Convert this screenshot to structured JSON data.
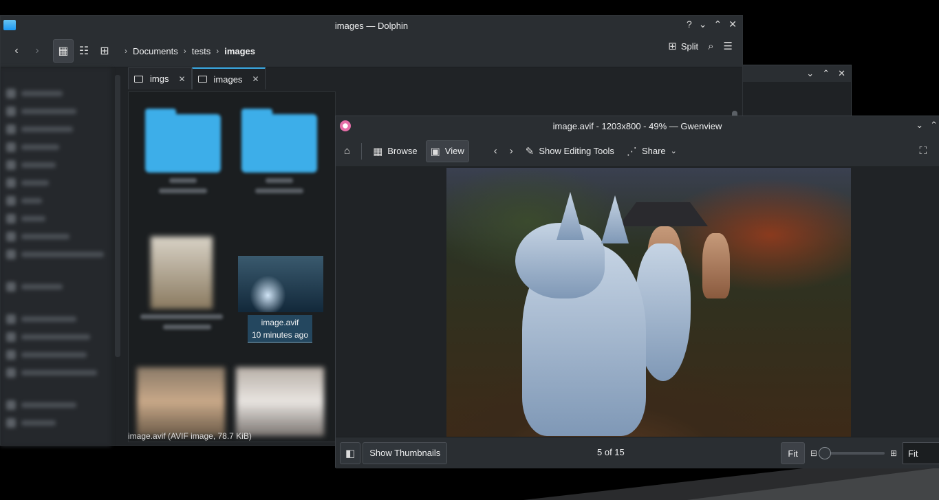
{
  "dolphin": {
    "title": "images — Dolphin",
    "breadcrumb": [
      "Documents",
      "tests",
      "images"
    ],
    "split_label": "Split",
    "tabs": [
      {
        "label": "imgs"
      },
      {
        "label": "images"
      }
    ],
    "selected_file": {
      "name": "image.avif",
      "time": "10 minutes ago"
    },
    "status_text": "image.avif (AVIF image, 78.7 KiB)"
  },
  "gwenview": {
    "title": "image.avif - 1203x800 - 49% — Gwenview",
    "toolbar": {
      "browse_label": "Browse",
      "view_label": "View",
      "editing_tools_label": "Show Editing Tools",
      "share_label": "Share"
    },
    "bottom": {
      "thumbnails_label": "Show Thumbnails",
      "counter": "5 of 15",
      "fit_button": "Fit",
      "zoom_select": "Fit",
      "zoom_level": 0
    }
  },
  "colors": {
    "accent": "#3daee9",
    "selection": "#24475f",
    "window_bg": "#202326",
    "toolbar_bg": "#2a2e32"
  }
}
